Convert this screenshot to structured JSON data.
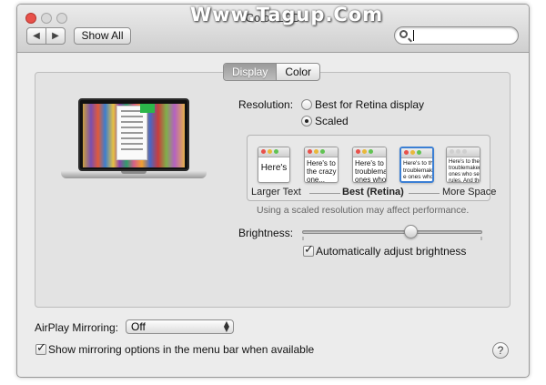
{
  "window": {
    "title": "Color LCD",
    "watermark": "Www.Tagup.Com"
  },
  "toolbar": {
    "back_icon": "◀",
    "forward_icon": "▶",
    "show_all_label": "Show All",
    "search_value": "",
    "search_icon": "magnifying-glass"
  },
  "tabs": [
    {
      "label": "Display",
      "selected": true
    },
    {
      "label": "Color",
      "selected": false
    }
  ],
  "resolution": {
    "label": "Resolution:",
    "options": [
      {
        "label": "Best for Retina display",
        "selected": false
      },
      {
        "label": "Scaled",
        "selected": true
      }
    ],
    "preview_window_1": "Here's",
    "preview_window_2": "Here's to\nthe crazy\none...",
    "preview_window_3": "Here's to the\ntroublemake\nones who s",
    "preview_window_4": "Here's to the c\ntroublemakers\ne ones who see\nrules. And the",
    "preview_window_5": "Here's to the cr\ntroublemakers. Th\nones who see thi\nrules. And they h",
    "scale_labels": {
      "left": "Larger Text",
      "middle": "Best (Retina)",
      "right": "More Space"
    },
    "note": "Using a scaled resolution may affect performance."
  },
  "brightness": {
    "label": "Brightness:",
    "value": 0.5,
    "auto_label": "Automatically adjust brightness",
    "auto_checked": true
  },
  "airplay": {
    "label": "AirPlay Mirroring:",
    "value": "Off"
  },
  "mirroring_option": {
    "label": "Show mirroring options in the menu bar when available",
    "checked": true
  },
  "help_label": "?",
  "colors": {
    "close": "#e8514a",
    "selection_blue": "#3b7fd4"
  }
}
